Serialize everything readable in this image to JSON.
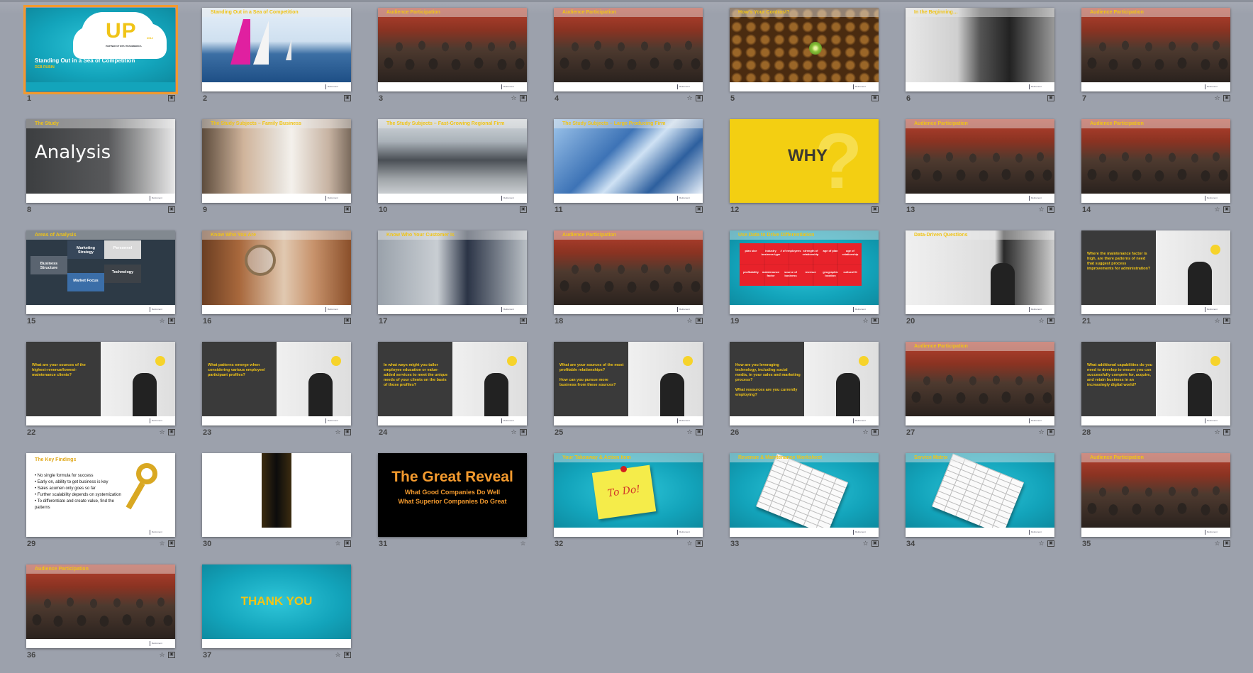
{
  "slides": [
    {
      "n": "1",
      "kind": "cover",
      "title": "Standing Out in a Sea of Competition",
      "presenter": "DEB RUBIN",
      "logo": "UP",
      "logo_year": "2012",
      "logo_line": "PARTNER UP WITH TRADEMERICA",
      "icons": [
        "slide-icon"
      ],
      "selected": true
    },
    {
      "n": "2",
      "kind": "sail",
      "title": "Standing Out in a Sea of Competition",
      "icons": [
        "slide-icon"
      ]
    },
    {
      "n": "3",
      "kind": "audience",
      "title": "Audience Participation",
      "icons": [
        "star-icon",
        "slide-icon"
      ]
    },
    {
      "n": "4",
      "kind": "audience",
      "title": "Audience Participation",
      "icons": [
        "star-icon",
        "slide-icon"
      ]
    },
    {
      "n": "5",
      "kind": "coffee",
      "title": "How's Your Contrast?",
      "icons": [
        "slide-icon"
      ]
    },
    {
      "n": "6",
      "kind": "bw",
      "title": "In the Beginning…",
      "icons": [
        "slide-icon"
      ]
    },
    {
      "n": "7",
      "kind": "audience",
      "title": "Audience Participation",
      "icons": [
        "star-icon",
        "slide-icon"
      ]
    },
    {
      "n": "8",
      "kind": "analysis",
      "title": "The Study",
      "big": "Analysis",
      "icons": [
        "slide-icon"
      ]
    },
    {
      "n": "9",
      "kind": "men",
      "title": "The Study Subjects – Family Business",
      "icons": [
        "slide-icon"
      ]
    },
    {
      "n": "10",
      "kind": "car",
      "title": "The Study Subjects – Fast-Growing Regional Firm",
      "icons": [
        "slide-icon"
      ]
    },
    {
      "n": "11",
      "kind": "bldg",
      "title": "The Study Subjects – Large Producing Firm",
      "icons": [
        "slide-icon"
      ]
    },
    {
      "n": "12",
      "kind": "why",
      "big": "WHY",
      "icons": [
        "slide-icon"
      ]
    },
    {
      "n": "13",
      "kind": "audience",
      "title": "Audience Participation",
      "icons": [
        "star-icon",
        "slide-icon"
      ]
    },
    {
      "n": "14",
      "kind": "audience",
      "title": "Audience Participation",
      "icons": [
        "star-icon",
        "slide-icon"
      ]
    },
    {
      "n": "15",
      "kind": "areas",
      "title": "Areas of Analysis",
      "areas": [
        "Marketing Strategy",
        "Personnel",
        "Business Structure",
        "Market Focus",
        "Technology"
      ],
      "icons": [
        "star-icon",
        "slide-icon"
      ]
    },
    {
      "n": "16",
      "kind": "eye",
      "title": "Know Who You Are",
      "icons": [
        "slide-icon"
      ]
    },
    {
      "n": "17",
      "kind": "garage",
      "title": "Know Who Your Customer Is",
      "icons": [
        "slide-icon"
      ]
    },
    {
      "n": "18",
      "kind": "audience",
      "title": "Audience Participation",
      "icons": [
        "star-icon",
        "slide-icon"
      ]
    },
    {
      "n": "19",
      "kind": "puzzle",
      "title": "Use Data to Drive Differentiation",
      "pieces": [
        "plan size",
        "industry business type",
        "# of employees",
        "strength of relationship",
        "age of plan",
        "age of relationship",
        "profitability",
        "maintenance factor",
        "source of business",
        "revenue",
        "geographic location",
        "cultural fit"
      ],
      "icons": [
        "star-icon",
        "slide-icon"
      ]
    },
    {
      "n": "20",
      "kind": "board",
      "title": "Data-Driven Questions",
      "icons": [
        "star-icon",
        "slide-icon"
      ]
    },
    {
      "n": "21",
      "kind": "question",
      "text": "Where the maintenance factor is high, are there patterns of need that suggest process improvements for administration?",
      "icons": [
        "star-icon",
        "slide-icon"
      ]
    },
    {
      "n": "22",
      "kind": "question",
      "text": "What are your sources of the highest-revenue/lowest-maintenance clients?",
      "icons": [
        "star-icon",
        "slide-icon"
      ]
    },
    {
      "n": "23",
      "kind": "question",
      "text": "What patterns emerge when considering various employee/ participant profiles?",
      "icons": [
        "star-icon",
        "slide-icon"
      ]
    },
    {
      "n": "24",
      "kind": "question",
      "text": "In what ways might you tailor employee education or value-added services to meet the unique needs of your clients on the basis of those profiles?",
      "icons": [
        "star-icon",
        "slide-icon"
      ]
    },
    {
      "n": "25",
      "kind": "question",
      "text": "What are your sources of the most profitable relationships?\n\nHow can you pursue more business from these sources?",
      "icons": [
        "star-icon",
        "slide-icon"
      ]
    },
    {
      "n": "26",
      "kind": "question",
      "text": "How are you leveraging technology, including social media, in your sales and marketing process?\n\nWhat resources are you currently employing?",
      "icons": [
        "star-icon",
        "slide-icon"
      ]
    },
    {
      "n": "27",
      "kind": "audience",
      "title": "Audience Participation",
      "icons": [
        "star-icon",
        "slide-icon"
      ]
    },
    {
      "n": "28",
      "kind": "question",
      "text": "What additional capabilities do you need to develop to ensure you can successfully compete for, acquire, and retain business in an increasingly digital world?",
      "icons": [
        "star-icon",
        "slide-icon"
      ]
    },
    {
      "n": "29",
      "kind": "findings",
      "title": "The Key Findings",
      "bullets": [
        "No single formula for success",
        "Early on, ability to get business is key",
        "Sales acumen only goes so far",
        "Further scalability depends on systemization",
        "To differentiate and create value, find the patterns"
      ],
      "icons": [
        "star-icon",
        "slide-icon"
      ]
    },
    {
      "n": "30",
      "kind": "keyhole",
      "icons": [
        "star-icon",
        "slide-icon"
      ]
    },
    {
      "n": "31",
      "kind": "reveal",
      "big": "The Great Reveal",
      "line1": "What Good Companies Do Well",
      "line2": "What Superior Companies Do Great",
      "icons": [
        "star-icon"
      ]
    },
    {
      "n": "32",
      "kind": "todo",
      "title": "Your Takeaway & Action Item",
      "note": "To Do!",
      "icons": [
        "star-icon",
        "slide-icon"
      ]
    },
    {
      "n": "33",
      "kind": "sheet",
      "title": "Revenue & Maintenance Worksheet",
      "icons": [
        "star-icon",
        "slide-icon"
      ]
    },
    {
      "n": "34",
      "kind": "sheet",
      "title": "Service Matrix",
      "icons": [
        "star-icon",
        "slide-icon"
      ]
    },
    {
      "n": "35",
      "kind": "audience",
      "title": "Audience Participation",
      "icons": [
        "star-icon",
        "slide-icon"
      ]
    },
    {
      "n": "36",
      "kind": "audience",
      "title": "Audience Participation",
      "icons": [
        "star-icon",
        "slide-icon"
      ]
    },
    {
      "n": "37",
      "kind": "thanks",
      "big": "THANK YOU",
      "icons": [
        "star-icon",
        "slide-icon"
      ]
    }
  ],
  "footer_logo": "Retirement",
  "colors": {
    "accent_title": "#f0c417",
    "selection": "#f29a2e",
    "teal": "#13a4bb",
    "window_bg": "#9ca1ac"
  }
}
